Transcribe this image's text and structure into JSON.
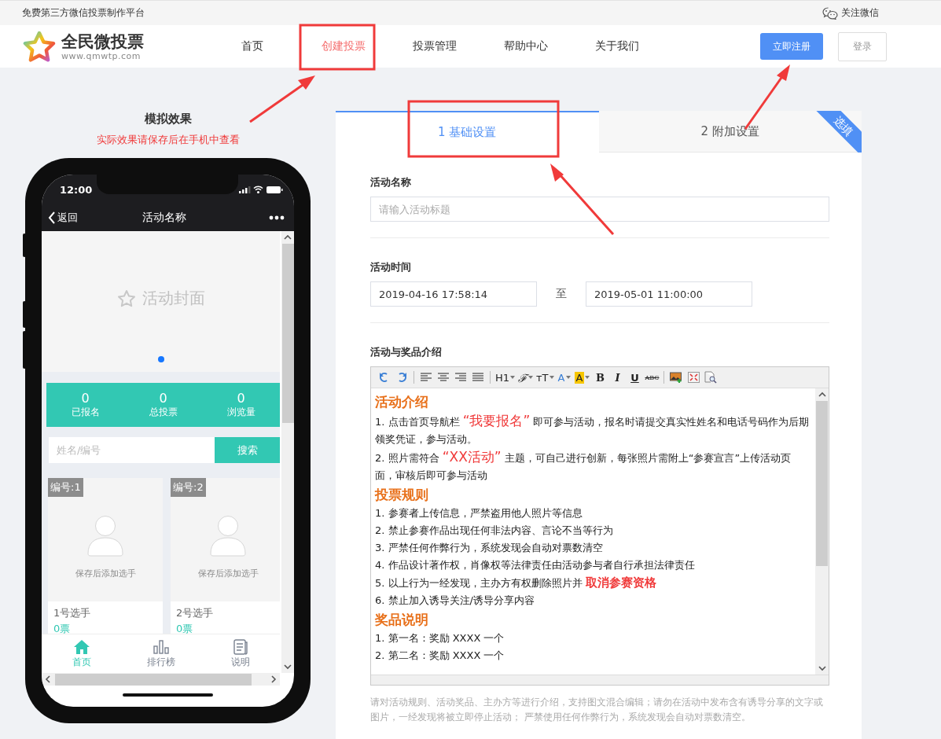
{
  "top_bar": {
    "tagline": "免费第三方微信投票制作平台",
    "follow": "关注微信"
  },
  "header": {
    "logo": {
      "name": "全民微投票",
      "url": "www.qmwtp.com"
    },
    "nav": [
      {
        "label": "首页",
        "selected": false
      },
      {
        "label": "创建投票",
        "selected": true
      },
      {
        "label": "投票管理",
        "selected": false
      },
      {
        "label": "帮助中心",
        "selected": false
      },
      {
        "label": "关于我们",
        "selected": false
      }
    ],
    "register": "立即注册",
    "login": "登录"
  },
  "preview": {
    "title": "模拟效果",
    "subtitle": "实际效果请保存后在手机中查看",
    "phone": {
      "time": "12:00",
      "back": "返回",
      "title": "活动名称",
      "cover": "活动封面",
      "stats": [
        {
          "value": "0",
          "label": "已报名"
        },
        {
          "value": "0",
          "label": "总投票"
        },
        {
          "value": "0",
          "label": "浏览量"
        }
      ],
      "search": {
        "placeholder": "姓名/编号",
        "button": "搜索"
      },
      "contestants": [
        {
          "badge": "编号:1",
          "hint": "保存后添加选手",
          "name": "1号选手",
          "votes": "0票"
        },
        {
          "badge": "编号:2",
          "hint": "保存后添加选手",
          "name": "2号选手",
          "votes": "0票"
        }
      ],
      "tabs": [
        {
          "kind": "home",
          "label": "首页",
          "selected": true
        },
        {
          "kind": "ranking",
          "label": "排行榜",
          "selected": false
        },
        {
          "kind": "info",
          "label": "说明",
          "selected": false
        }
      ]
    }
  },
  "form": {
    "tabs": [
      {
        "label": "1 基础设置",
        "selected": true
      },
      {
        "label": "2 附加设置",
        "selected": false
      }
    ],
    "ribbon": "选填",
    "name": {
      "label": "活动名称",
      "placeholder": "请输入活动标题"
    },
    "time": {
      "label": "活动时间",
      "start": "2019-04-16 17:58:14",
      "to": "至",
      "end": "2019-05-01 11:00:00"
    },
    "intro": {
      "label": "活动与奖品介绍",
      "toolbar": [
        [
          {
            "kind": "undo"
          },
          {
            "kind": "redo"
          }
        ],
        [
          {
            "kind": "align-left"
          },
          {
            "kind": "align-center"
          },
          {
            "kind": "align-right"
          },
          {
            "kind": "justify"
          }
        ],
        [
          {
            "kind": "heading",
            "label": "H1"
          },
          {
            "kind": "font",
            "label": "ℱ"
          },
          {
            "kind": "size",
            "label": "ᴛT"
          },
          {
            "kind": "font-color",
            "label": "A"
          },
          {
            "kind": "highlight",
            "label": "A"
          },
          {
            "kind": "bold",
            "label": "B"
          },
          {
            "kind": "italic",
            "label": "I"
          },
          {
            "kind": "underline",
            "label": "U"
          },
          {
            "kind": "strike",
            "label": "ABC"
          }
        ],
        [
          {
            "kind": "image"
          },
          {
            "kind": "fullscreen"
          },
          {
            "kind": "preview"
          }
        ]
      ],
      "content": [
        {
          "kind": "heading",
          "text": "活动介绍"
        },
        {
          "kind": "item",
          "parts": [
            {
              "kind": "plain",
              "text": "1. 点击首页导航栏 "
            },
            {
              "kind": "quote",
              "text": "“我要报名”"
            },
            {
              "kind": "plain",
              "text": " 即可参与活动，报名时请提交真实性姓名和电话号码作为后期领奖凭证，参与活动。"
            }
          ]
        },
        {
          "kind": "item",
          "parts": [
            {
              "kind": "plain",
              "text": "2. 照片需符合 "
            },
            {
              "kind": "quote",
              "text": "“XX活动”"
            },
            {
              "kind": "plain",
              "text": " 主题，可自己进行创新，每张照片需附上“参赛宣言”上传活动页面，审核后即可参与活动"
            }
          ]
        },
        {
          "kind": "heading",
          "text": "投票规则"
        },
        {
          "kind": "item",
          "parts": [
            {
              "kind": "plain",
              "text": "1. 参赛者上传信息，严禁盗用他人照片等信息"
            }
          ]
        },
        {
          "kind": "item",
          "parts": [
            {
              "kind": "plain",
              "text": "2. 禁止参赛作品出现任何非法内容、言论不当等行为"
            }
          ]
        },
        {
          "kind": "item",
          "parts": [
            {
              "kind": "plain",
              "text": "3. 严禁任何作弊行为，系统发现会自动对票数清空"
            }
          ]
        },
        {
          "kind": "item",
          "parts": [
            {
              "kind": "plain",
              "text": "4. 作品设计著作权，肖像权等法律责任由活动参与者自行承担法律责任"
            }
          ]
        },
        {
          "kind": "item",
          "parts": [
            {
              "kind": "plain",
              "text": "5. 以上行为一经发现，主办方有权删除照片并 "
            },
            {
              "kind": "warning",
              "text": "取消参赛资格"
            }
          ]
        },
        {
          "kind": "item",
          "parts": [
            {
              "kind": "plain",
              "text": "6. 禁止加入诱导关注/诱导分享内容"
            }
          ]
        },
        {
          "kind": "heading",
          "text": "奖品说明"
        },
        {
          "kind": "item",
          "parts": [
            {
              "kind": "plain",
              "text": "1. 第一名：奖励 XXXX 一个"
            }
          ]
        },
        {
          "kind": "item",
          "parts": [
            {
              "kind": "plain",
              "text": "2. 第二名：奖励 XXXX 一个"
            }
          ]
        }
      ],
      "hint": "请对活动规则、活动奖品、主办方等进行介绍，支持图文混合编辑；请勿在活动中发布含有诱导分享的文字或图片，一经发现将被立即停止活动； 严禁使用任何作弊行为，系统发现会自动对票数清空。"
    }
  }
}
